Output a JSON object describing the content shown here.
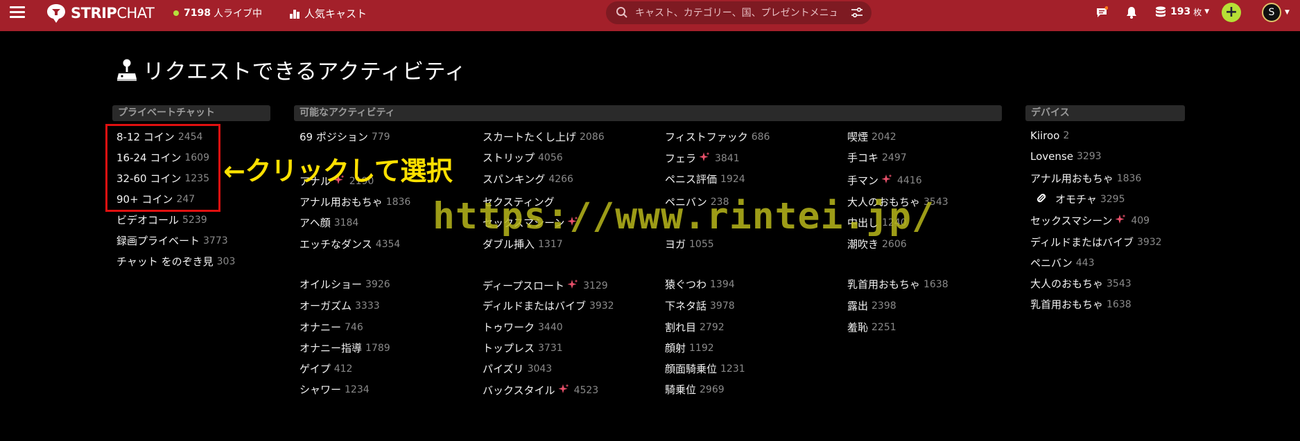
{
  "header": {
    "logo_bold": "STRIP",
    "logo_thin": "CHAT",
    "live_count": "7198",
    "live_label": "人ライブ中",
    "popular_label": "人気キャスト",
    "search_placeholder": "キャスト、カテゴリー、国、プレゼントメニュ",
    "coins_value": "193",
    "coins_unit": "枚",
    "plus_label": "+",
    "avatar_initial": "S",
    "accent_color": "#a3202a",
    "live_dot_color": "#b6e03c"
  },
  "page": {
    "title": "リクエストできるアクティビティ"
  },
  "private_chat": {
    "heading": "プライベートチャット",
    "items": [
      {
        "label": "8-12 コイン",
        "count": "2454"
      },
      {
        "label": "16-24 コイン",
        "count": "1609"
      },
      {
        "label": "32-60 コイン",
        "count": "1235"
      },
      {
        "label": "90+ コイン",
        "count": "247"
      },
      {
        "label": "ビデオコール",
        "count": "5239"
      },
      {
        "label": "録画プライベート",
        "count": "3773"
      },
      {
        "label": "チャット をのぞき見",
        "count": "303"
      }
    ]
  },
  "activities": {
    "heading": "可能なアクティビティ",
    "columns": [
      [
        {
          "label": "69 ポジション",
          "count": "779"
        },
        {
          "label": "アナル",
          "count": "2190",
          "sparkle": true
        },
        {
          "label": "アナル用おもちゃ",
          "count": "1836"
        },
        {
          "label": "アヘ顔",
          "count": "3184"
        },
        {
          "label": "エッチなダンス",
          "count": "4354"
        },
        {
          "label": "オイルショー",
          "count": "3926"
        },
        {
          "label": "オーガズム",
          "count": "3333"
        },
        {
          "label": "オナニー",
          "count": "746"
        },
        {
          "label": "オナニー指導",
          "count": "1789"
        },
        {
          "label": "ゲイプ",
          "count": "412"
        },
        {
          "label": "シャワー",
          "count": "1234"
        }
      ],
      [
        {
          "label": "スカートたくし上げ",
          "count": "2086"
        },
        {
          "label": "ストリップ",
          "count": "4056"
        },
        {
          "label": "スパンキング",
          "count": "4266"
        },
        {
          "label": "セクスティング",
          "count": ""
        },
        {
          "label": "セックスマシーン",
          "count": "",
          "sparkle": true
        },
        {
          "label": "ダブル挿入",
          "count": "1317"
        },
        {
          "label": "ディープスロート",
          "count": "3129",
          "sparkle": true
        },
        {
          "label": "ディルドまたはバイブ",
          "count": "3932"
        },
        {
          "label": "トゥワーク",
          "count": "3440"
        },
        {
          "label": "トップレス",
          "count": "3731"
        },
        {
          "label": "パイズリ",
          "count": "3043"
        },
        {
          "label": "バックスタイル",
          "count": "4523",
          "sparkle": true
        }
      ],
      [
        {
          "label": "フィストファック",
          "count": "686"
        },
        {
          "label": "フェラ",
          "count": "3841",
          "sparkle": true
        },
        {
          "label": "ペニス評価",
          "count": "1924"
        },
        {
          "label": "ペニバン",
          "count": "238"
        },
        {
          "label": "ヨガ",
          "count": "1055"
        },
        {
          "label": "猿ぐつわ",
          "count": "1394"
        },
        {
          "label": "下ネタ話",
          "count": "3978"
        },
        {
          "label": "割れ目",
          "count": "2792"
        },
        {
          "label": "顔射",
          "count": "1192"
        },
        {
          "label": "顔面騎乗位",
          "count": "1231"
        },
        {
          "label": "騎乗位",
          "count": "2969"
        }
      ],
      [
        {
          "label": "喫煙",
          "count": "2042"
        },
        {
          "label": "手コキ",
          "count": "2497"
        },
        {
          "label": "手マン",
          "count": "4416",
          "sparkle": true
        },
        {
          "label": "大人のおもちゃ",
          "count": "3543"
        },
        {
          "label": "中出し",
          "count": "1240"
        },
        {
          "label": "潮吹き",
          "count": "2606"
        },
        {
          "label": "乳首用おもちゃ",
          "count": "1638"
        },
        {
          "label": "露出",
          "count": "2398"
        },
        {
          "label": "羞恥",
          "count": "2251"
        }
      ]
    ]
  },
  "devices": {
    "heading": "デバイス",
    "items": [
      {
        "label": "Kiiroo",
        "count": "2"
      },
      {
        "label": "Lovense",
        "count": "3293"
      },
      {
        "label": "アナル用おもちゃ",
        "count": "1836"
      },
      {
        "label": "オモチャ",
        "count": "3295",
        "icon": "toy-icon"
      },
      {
        "label": "セックスマシーン",
        "count": "409",
        "sparkle": true
      },
      {
        "label": "ディルドまたはバイブ",
        "count": "3932"
      },
      {
        "label": "ペニバン",
        "count": "443"
      },
      {
        "label": "大人のおもちゃ",
        "count": "3543"
      },
      {
        "label": "乳首用おもちゃ",
        "count": "1638"
      }
    ]
  },
  "annotations": {
    "click_note": "←クリックして選択",
    "watermark": "https://www.rintei.jp/"
  }
}
